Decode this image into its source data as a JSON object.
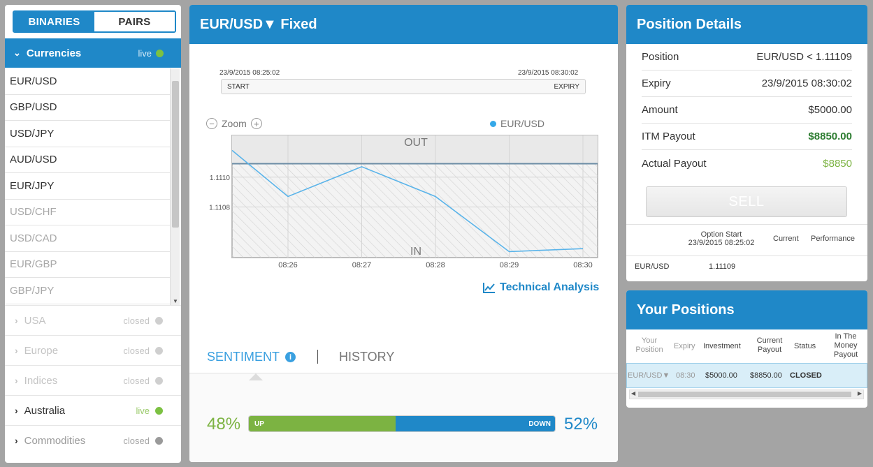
{
  "left": {
    "toggle": {
      "binaries": "BINARIES",
      "pairs": "PAIRS"
    },
    "currencies": {
      "label": "Currencies",
      "status": "live"
    },
    "currency_items": [
      {
        "label": "EUR/USD"
      },
      {
        "label": "GBP/USD"
      },
      {
        "label": "USD/JPY"
      },
      {
        "label": "AUD/USD"
      },
      {
        "label": "EUR/JPY"
      },
      {
        "label": "USD/CHF"
      },
      {
        "label": "USD/CAD"
      },
      {
        "label": "EUR/GBP"
      },
      {
        "label": "GBP/JPY"
      }
    ],
    "markets": [
      {
        "label": "USA",
        "status": "closed"
      },
      {
        "label": "Europe",
        "status": "closed"
      },
      {
        "label": "Indices",
        "status": "closed"
      },
      {
        "label": "Australia",
        "status": "live"
      },
      {
        "label": "Commodities",
        "status": "closed"
      }
    ]
  },
  "center": {
    "title": "EUR/USD▼ Fixed",
    "start_time": "23/9/2015 08:25:02",
    "expiry_time": "23/9/2015 08:30:02",
    "start_label": "START",
    "expiry_label": "EXPIRY",
    "zoom_label": "Zoom",
    "legend_label": "EUR/USD",
    "technical_analysis": "Technical Analysis",
    "tabs": {
      "sentiment": "SENTIMENT",
      "history": "HISTORY"
    },
    "sentiment": {
      "up_pct": "48%",
      "down_pct": "52%",
      "up_label": "UP",
      "down_label": "DOWN",
      "up_value": 48,
      "down_value": 52
    }
  },
  "chart_data": {
    "type": "line",
    "series": [
      {
        "name": "EUR/USD",
        "x": [
          "08:25:02",
          "08:26",
          "08:27",
          "08:28",
          "08:29",
          "08:30"
        ],
        "y": [
          1.11118,
          1.11087,
          1.11107,
          1.11087,
          1.1105,
          1.11052
        ]
      }
    ],
    "xticks": [
      "08:26",
      "08:27",
      "08:28",
      "08:29",
      "08:30"
    ],
    "yticks": [
      "1.1110",
      "1.1108"
    ],
    "zone_labels": {
      "above": "OUT",
      "below": "IN"
    },
    "strike": 1.11109,
    "ylim": [
      1.11046,
      1.11128
    ],
    "grid": true,
    "color": "#5ab4ea"
  },
  "details": {
    "title": "Position Details",
    "rows": [
      {
        "label": "Position",
        "value": "EUR/USD < 1.11109"
      },
      {
        "label": "Expiry",
        "value": "23/9/2015 08:30:02"
      },
      {
        "label": "Amount",
        "value": "$5000.00"
      },
      {
        "label": "ITM Payout",
        "value": "$8850.00"
      },
      {
        "label": "Actual Payout",
        "value": "$8850"
      }
    ],
    "sell_label": "SELL",
    "table": {
      "headers": [
        "Option Start",
        "23/9/2015 08:25:02",
        "Current",
        "Performance"
      ],
      "row": {
        "asset": "EUR/USD",
        "start": "1.11109"
      }
    }
  },
  "positions": {
    "title": "Your Positions",
    "headers": [
      "Your Position",
      "Expiry",
      "Investment",
      "Current Payout",
      "Status",
      "In The Money Payout"
    ],
    "rows": [
      {
        "position": "EUR/USD▼",
        "expiry": "08:30",
        "investment": "$5000.00",
        "current_payout": "$8850.00",
        "status": "CLOSED"
      }
    ]
  },
  "colors": {
    "accent": "#1f88c8",
    "up": "#7cb342",
    "live": "#7cc142"
  }
}
